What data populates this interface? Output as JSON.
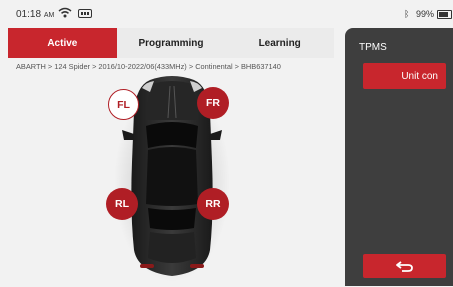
{
  "status": {
    "time": "01:18",
    "ampm": "AM",
    "battery": "99%"
  },
  "tabs": [
    {
      "label": "Active",
      "active": true
    },
    {
      "label": "Programming",
      "active": false
    },
    {
      "label": "Learning",
      "active": false
    }
  ],
  "breadcrumb": "ABARTH > 124 Spider > 2016/10-2022/06(433MHz) > Continental > BHB637140",
  "tires": {
    "fl": "FL",
    "fr": "FR",
    "rl": "RL",
    "rr": "RR"
  },
  "panel": {
    "title": "TPMS",
    "unit_button": "Unit con"
  },
  "colors": {
    "accent": "#c8262d",
    "panel": "#3e3e3e"
  }
}
